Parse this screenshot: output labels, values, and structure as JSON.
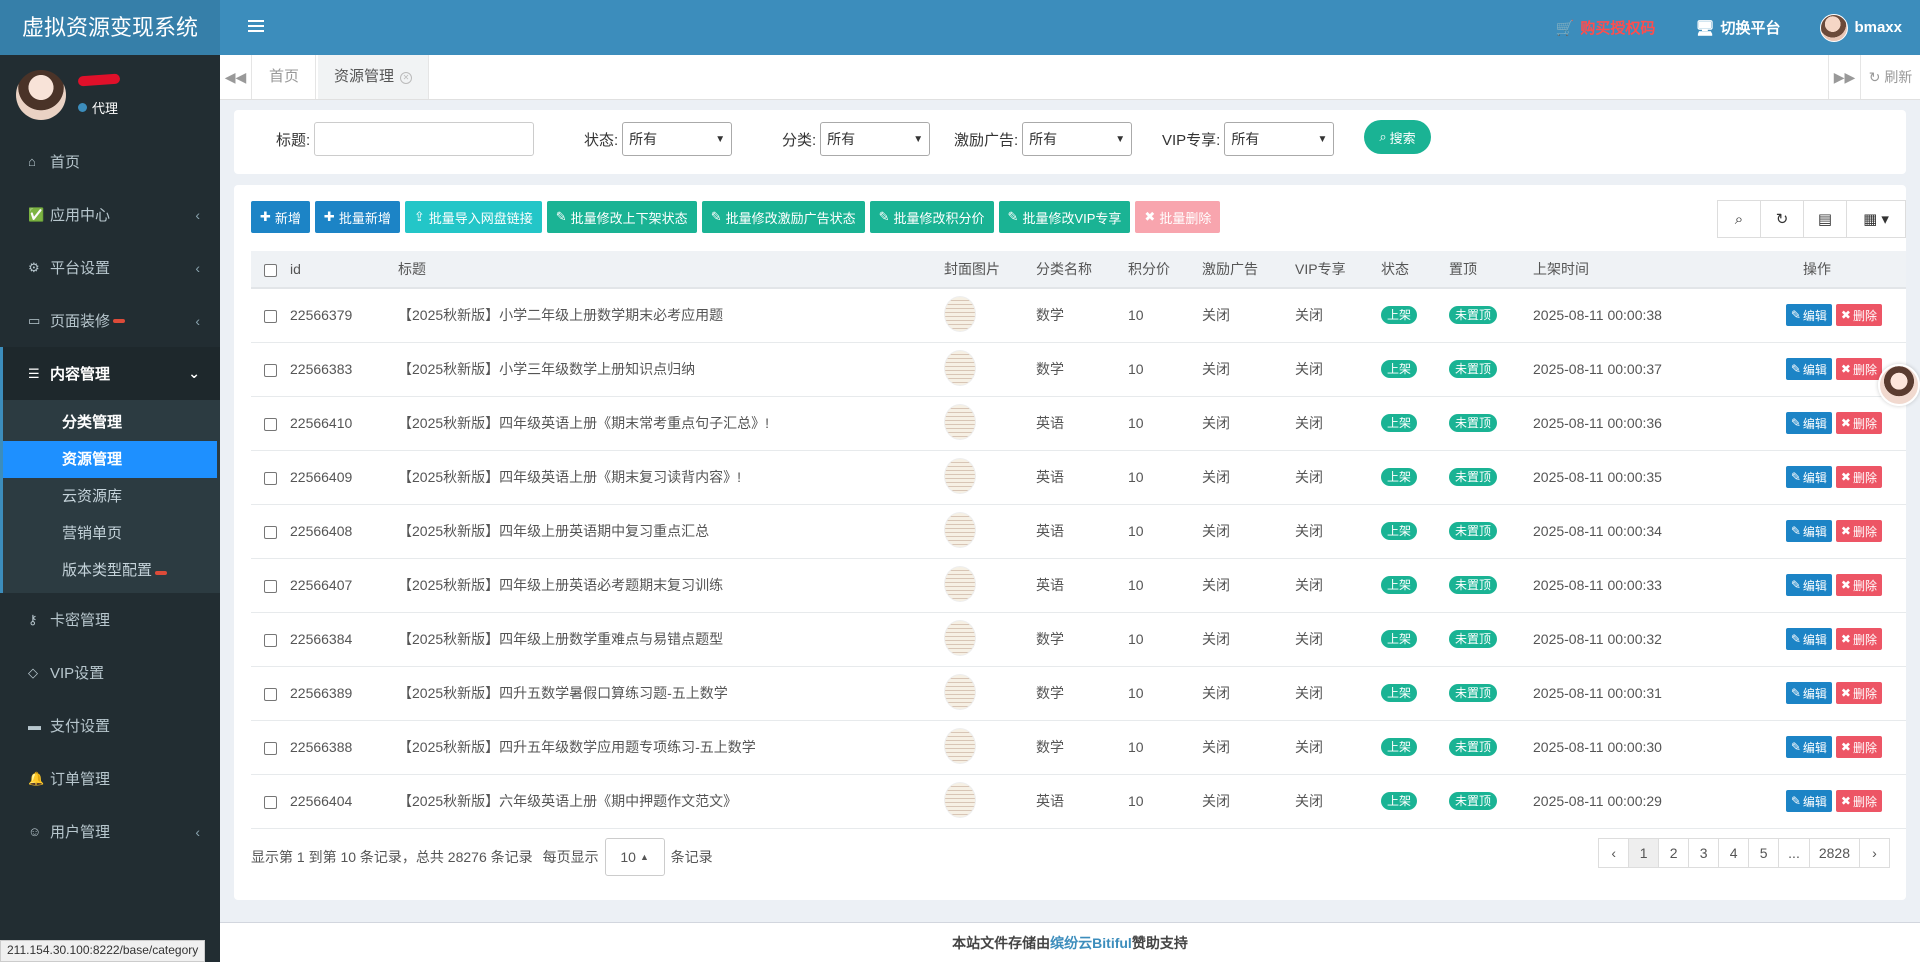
{
  "app": {
    "title": "虚拟资源变现系统"
  },
  "header": {
    "buy_label": "购买授权码",
    "switch_label": "切换平台",
    "username": "bmaxx"
  },
  "sidebar": {
    "user_role": "代理",
    "menu": [
      {
        "label": "首页",
        "icon": "home-icon"
      },
      {
        "label": "应用中心",
        "icon": "check-square-icon"
      },
      {
        "label": "平台设置",
        "icon": "gear-icon"
      },
      {
        "label": "页面装修",
        "icon": "monitor-icon"
      },
      {
        "label": "内容管理",
        "icon": "database-icon"
      }
    ],
    "submenu": [
      "分类管理",
      "资源管理",
      "云资源库",
      "营销单页",
      "版本类型配置"
    ],
    "menu_after": [
      {
        "label": "卡密管理",
        "icon": "key-icon"
      },
      {
        "label": "VIP设置",
        "icon": "diamond-icon"
      },
      {
        "label": "支付设置",
        "icon": "credit-card-icon"
      },
      {
        "label": "订单管理",
        "icon": "bell-icon"
      },
      {
        "label": "用户管理",
        "icon": "user-icon"
      }
    ],
    "status_url": "211.154.30.100:8222/base/category"
  },
  "tabs": {
    "home": "首页",
    "active": "资源管理",
    "refresh": "刷新"
  },
  "search": {
    "title_label": "标题:",
    "status_label": "状态:",
    "category_label": "分类:",
    "ad_label": "激励广告:",
    "vip_label": "VIP专享:",
    "option_all": "所有",
    "button": "搜索"
  },
  "toolbar": {
    "add": "新增",
    "batch_add": "批量新增",
    "batch_import": "批量导入网盘链接",
    "batch_status": "批量修改上下架状态",
    "batch_ad": "批量修改激励广告状态",
    "batch_points": "批量修改积分价",
    "batch_vip": "批量修改VIP专享",
    "batch_delete": "批量删除"
  },
  "table": {
    "headers": [
      "id",
      "标题",
      "封面图片",
      "分类名称",
      "积分价",
      "激励广告",
      "VIP专享",
      "状态",
      "置顶",
      "上架时间",
      "操作"
    ],
    "rows": [
      {
        "id": "22566379",
        "title": "【2025秋新版】小学二年级上册数学期末必考应用题",
        "category": "数学",
        "points": "10",
        "ad": "关闭",
        "vip": "关闭",
        "status": "上架",
        "top": "未置顶",
        "time": "2025-08-11 00:00:38"
      },
      {
        "id": "22566383",
        "title": "【2025秋新版】小学三年级数学上册知识点归纳",
        "category": "数学",
        "points": "10",
        "ad": "关闭",
        "vip": "关闭",
        "status": "上架",
        "top": "未置顶",
        "time": "2025-08-11 00:00:37"
      },
      {
        "id": "22566410",
        "title": "【2025秋新版】四年级英语上册《期末常考重点句子汇总》!",
        "category": "英语",
        "points": "10",
        "ad": "关闭",
        "vip": "关闭",
        "status": "上架",
        "top": "未置顶",
        "time": "2025-08-11 00:00:36"
      },
      {
        "id": "22566409",
        "title": "【2025秋新版】四年级英语上册《期末复习读背内容》!",
        "category": "英语",
        "points": "10",
        "ad": "关闭",
        "vip": "关闭",
        "status": "上架",
        "top": "未置顶",
        "time": "2025-08-11 00:00:35"
      },
      {
        "id": "22566408",
        "title": "【2025秋新版】四年级上册英语期中复习重点汇总",
        "category": "英语",
        "points": "10",
        "ad": "关闭",
        "vip": "关闭",
        "status": "上架",
        "top": "未置顶",
        "time": "2025-08-11 00:00:34"
      },
      {
        "id": "22566407",
        "title": "【2025秋新版】四年级上册英语必考题期末复习训练",
        "category": "英语",
        "points": "10",
        "ad": "关闭",
        "vip": "关闭",
        "status": "上架",
        "top": "未置顶",
        "time": "2025-08-11 00:00:33"
      },
      {
        "id": "22566384",
        "title": "【2025秋新版】四年级上册数学重难点与易错点题型",
        "category": "数学",
        "points": "10",
        "ad": "关闭",
        "vip": "关闭",
        "status": "上架",
        "top": "未置顶",
        "time": "2025-08-11 00:00:32"
      },
      {
        "id": "22566389",
        "title": "【2025秋新版】四升五数学暑假口算练习题-五上数学",
        "category": "数学",
        "points": "10",
        "ad": "关闭",
        "vip": "关闭",
        "status": "上架",
        "top": "未置顶",
        "time": "2025-08-11 00:00:31"
      },
      {
        "id": "22566388",
        "title": "【2025秋新版】四升五年级数学应用题专项练习-五上数学",
        "category": "数学",
        "points": "10",
        "ad": "关闭",
        "vip": "关闭",
        "status": "上架",
        "top": "未置顶",
        "time": "2025-08-11 00:00:30"
      },
      {
        "id": "22566404",
        "title": "【2025秋新版】六年级英语上册《期中押题作文范文》",
        "category": "英语",
        "points": "10",
        "ad": "关闭",
        "vip": "关闭",
        "status": "上架",
        "top": "未置顶",
        "time": "2025-08-11 00:00:29"
      }
    ],
    "edit_label": "编辑",
    "delete_label": "删除"
  },
  "pagination": {
    "summary": "显示第 1 到第 10 条记录，总共 28276 条记录",
    "per_page_prefix": "每页显示",
    "per_page_value": "10",
    "per_page_suffix": "条记录",
    "pages": [
      "‹",
      "1",
      "2",
      "3",
      "4",
      "5",
      "...",
      "2828",
      "›"
    ],
    "current": "1"
  },
  "footer": {
    "prefix": "本站文件存储由",
    "highlight": "缤纷云Bitiful",
    "suffix": "赞助支持"
  },
  "colors": {
    "header": "#3c8dbc",
    "sidebar": "#222d32",
    "primary": "#1c84c6",
    "success": "#1ab394",
    "danger": "#ed5565"
  }
}
